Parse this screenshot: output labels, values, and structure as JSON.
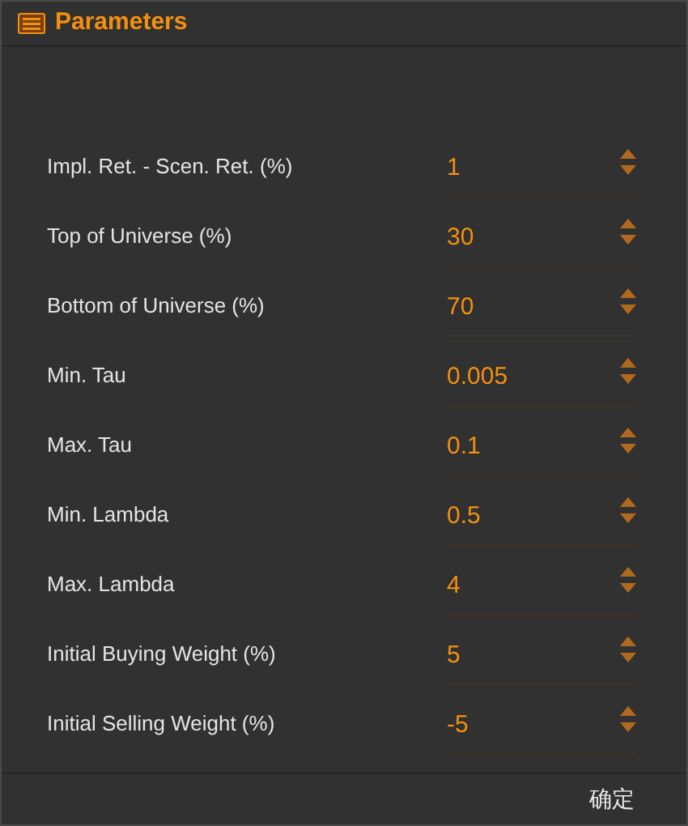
{
  "dialog": {
    "title": "Parameters"
  },
  "params": [
    {
      "label": "Impl. Ret. - Scen. Ret. (%)",
      "value": "1"
    },
    {
      "label": "Top of Universe (%)",
      "value": "30"
    },
    {
      "label": "Bottom of Universe (%)",
      "value": "70"
    },
    {
      "label": "Min. Tau",
      "value": "0.005"
    },
    {
      "label": "Max. Tau",
      "value": "0.1"
    },
    {
      "label": "Min. Lambda",
      "value": "0.5"
    },
    {
      "label": "Max. Lambda",
      "value": "4"
    },
    {
      "label": "Initial Buying Weight (%)",
      "value": "5"
    },
    {
      "label": "Initial Selling Weight (%)",
      "value": "-5"
    }
  ],
  "buttons": [
    "确定"
  ]
}
